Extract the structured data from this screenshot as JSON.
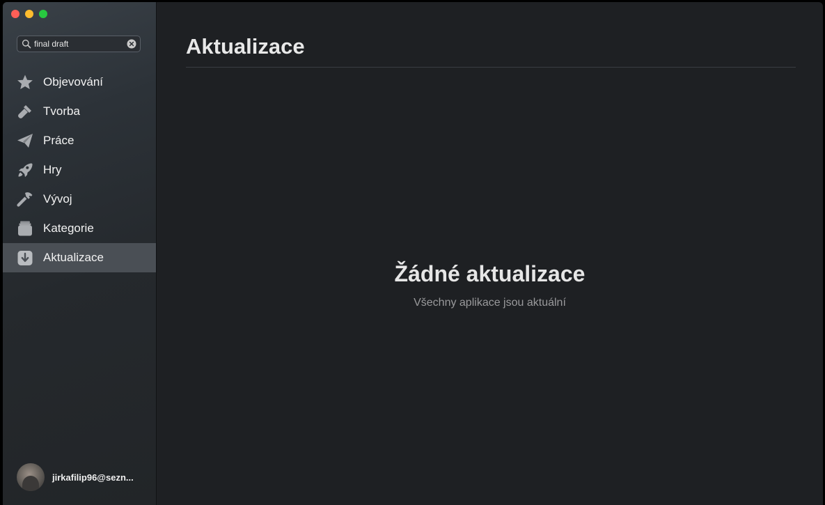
{
  "search": {
    "value": "final draft"
  },
  "sidebar": {
    "items": [
      {
        "label": "Objevování",
        "icon": "star-icon"
      },
      {
        "label": "Tvorba",
        "icon": "brush-icon"
      },
      {
        "label": "Práce",
        "icon": "paper-plane-icon"
      },
      {
        "label": "Hry",
        "icon": "rocket-icon"
      },
      {
        "label": "Vývoj",
        "icon": "hammer-icon"
      },
      {
        "label": "Kategorie",
        "icon": "stack-icon"
      },
      {
        "label": "Aktualizace",
        "icon": "download-icon",
        "active": true
      }
    ]
  },
  "account": {
    "name": "jirkafilip96@sezn..."
  },
  "main": {
    "title": "Aktualizace",
    "empty_title": "Žádné aktualizace",
    "empty_subtitle": "Všechny aplikace jsou aktuální"
  },
  "colors": {
    "window_bg": "#1e2023",
    "sidebar_active": "#4a4f55",
    "close": "#fe5f57",
    "minimize": "#febc2e",
    "maximize": "#28c840"
  }
}
